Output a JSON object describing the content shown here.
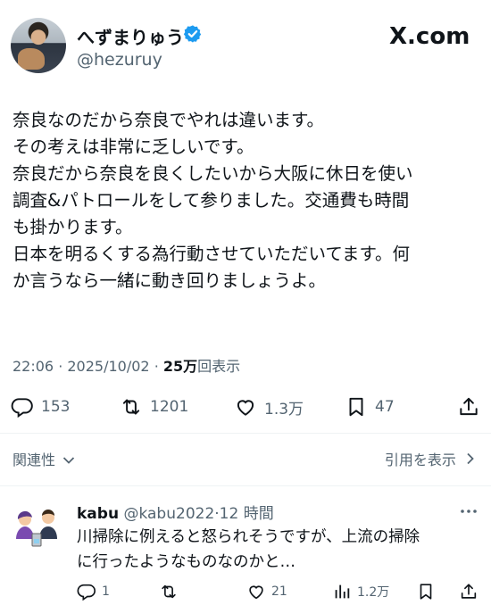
{
  "post": {
    "author_name": "へずまりゅう",
    "author_handle": "@hezuruy",
    "site_logo": "X.com",
    "body_lines": [
      "奈良なのだから奈良でやれは違います。",
      "その考えは非常に乏しいです。",
      "奈良だから奈良を良くしたいから大阪に休日を使い",
      "調査&パトロールをして参りました。交通費も時間",
      "も掛かります。",
      "日本を明るくする為行動させていただいてます。何",
      "か言うなら一緒に動き回りましょうよ。"
    ],
    "time": "22:06",
    "date": "2025/10/02",
    "views_count": "25万",
    "views_label": "回表示",
    "replies": "153",
    "reposts": "1201",
    "likes": "1.3万",
    "bookmarks": "47"
  },
  "links": {
    "related": "関連性",
    "show_quotes": "引用を表示"
  },
  "reply": {
    "name": "kabu",
    "handle": "@kabu2022",
    "age": "12 時間",
    "text_lines": [
      "川掃除に例えると怒られそうですが、上流の掃除",
      "に行ったようなものなのかと…"
    ],
    "replies": "1",
    "likes": "21",
    "views": "1.2万"
  },
  "colors": {
    "text": "#0f1419",
    "muted": "#536471",
    "verified": "#1d9bf0",
    "divider": "#eff3f4"
  },
  "icons": [
    "verified-badge-icon",
    "reply-icon",
    "repost-icon",
    "like-icon",
    "bookmark-icon",
    "share-icon",
    "chevron-down-icon",
    "chevron-right-icon",
    "more-icon",
    "views-icon"
  ]
}
